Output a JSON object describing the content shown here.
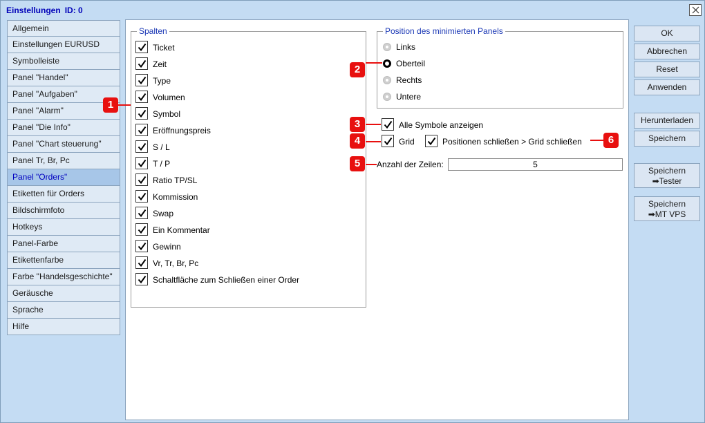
{
  "window": {
    "title": "Einstellungen",
    "id_label": "ID: 0"
  },
  "sidebar": {
    "items": [
      {
        "label": "Allgemein"
      },
      {
        "label": "Einstellungen EURUSD"
      },
      {
        "label": "Symbolleiste"
      },
      {
        "label": "Panel \"Handel\""
      },
      {
        "label": "Panel \"Aufgaben\""
      },
      {
        "label": "Panel \"Alarm\""
      },
      {
        "label": "Panel \"Die Info\""
      },
      {
        "label": "Panel \"Chart steuerung\""
      },
      {
        "label": "Panel Tr, Br, Pc"
      },
      {
        "label": "Panel \"Orders\"",
        "active": true
      },
      {
        "label": "Etiketten für Orders"
      },
      {
        "label": "Bildschirmfoto"
      },
      {
        "label": "Hotkeys"
      },
      {
        "label": "Panel-Farbe"
      },
      {
        "label": "Etikettenfarbe"
      },
      {
        "label": "Farbe \"Handelsgeschichte\""
      },
      {
        "label": "Geräusche"
      },
      {
        "label": "Sprache"
      },
      {
        "label": "Hilfe"
      }
    ]
  },
  "columns": {
    "title": "Spalten",
    "items": [
      {
        "label": "Ticket",
        "checked": true
      },
      {
        "label": "Zeit",
        "checked": true
      },
      {
        "label": "Type",
        "checked": true
      },
      {
        "label": "Volumen",
        "checked": true
      },
      {
        "label": "Symbol",
        "checked": true
      },
      {
        "label": "Eröffnungspreis",
        "checked": true
      },
      {
        "label": "S / L",
        "checked": true
      },
      {
        "label": "T / P",
        "checked": true
      },
      {
        "label": "Ratio TP/SL",
        "checked": true
      },
      {
        "label": "Kommission",
        "checked": true
      },
      {
        "label": "Swap",
        "checked": true
      },
      {
        "label": "Ein Kommentar",
        "checked": true
      },
      {
        "label": "Gewinn",
        "checked": true
      },
      {
        "label": "Vr, Tr, Br, Pc",
        "checked": true
      },
      {
        "label": "Schaltfläche zum Schließen einer Order",
        "checked": true
      }
    ]
  },
  "position": {
    "title": "Position des minimierten Panels",
    "options": [
      {
        "label": "Links",
        "selected": false
      },
      {
        "label": "Oberteil",
        "selected": true
      },
      {
        "label": "Rechts",
        "selected": false
      },
      {
        "label": "Untere",
        "selected": false
      }
    ]
  },
  "options": {
    "show_all_symbols": {
      "label": "Alle Symbole anzeigen",
      "checked": true
    },
    "grid": {
      "label": "Grid",
      "checked": true
    },
    "close_positions": {
      "label": "Positionen schließen > Grid schließen",
      "checked": true
    },
    "rows_label": "Anzahl der Zeilen:",
    "rows_value": "5"
  },
  "markers": [
    "1",
    "2",
    "3",
    "4",
    "5",
    "6"
  ],
  "buttons": {
    "ok": "OK",
    "cancel": "Abbrechen",
    "reset": "Reset",
    "apply": "Anwenden",
    "download": "Herunterladen",
    "save": "Speichern",
    "save_tester": {
      "line1": "Speichern",
      "line2": "➡Tester"
    },
    "save_vps": {
      "line1": "Speichern",
      "line2": "➡MT VPS"
    }
  },
  "colors": {
    "window_bg": "#c4dcf3",
    "title_text": "#0000b8",
    "group_title": "#1a37b5",
    "active_item_bg": "#a7c6e8",
    "marker_red": "#e8100f"
  }
}
